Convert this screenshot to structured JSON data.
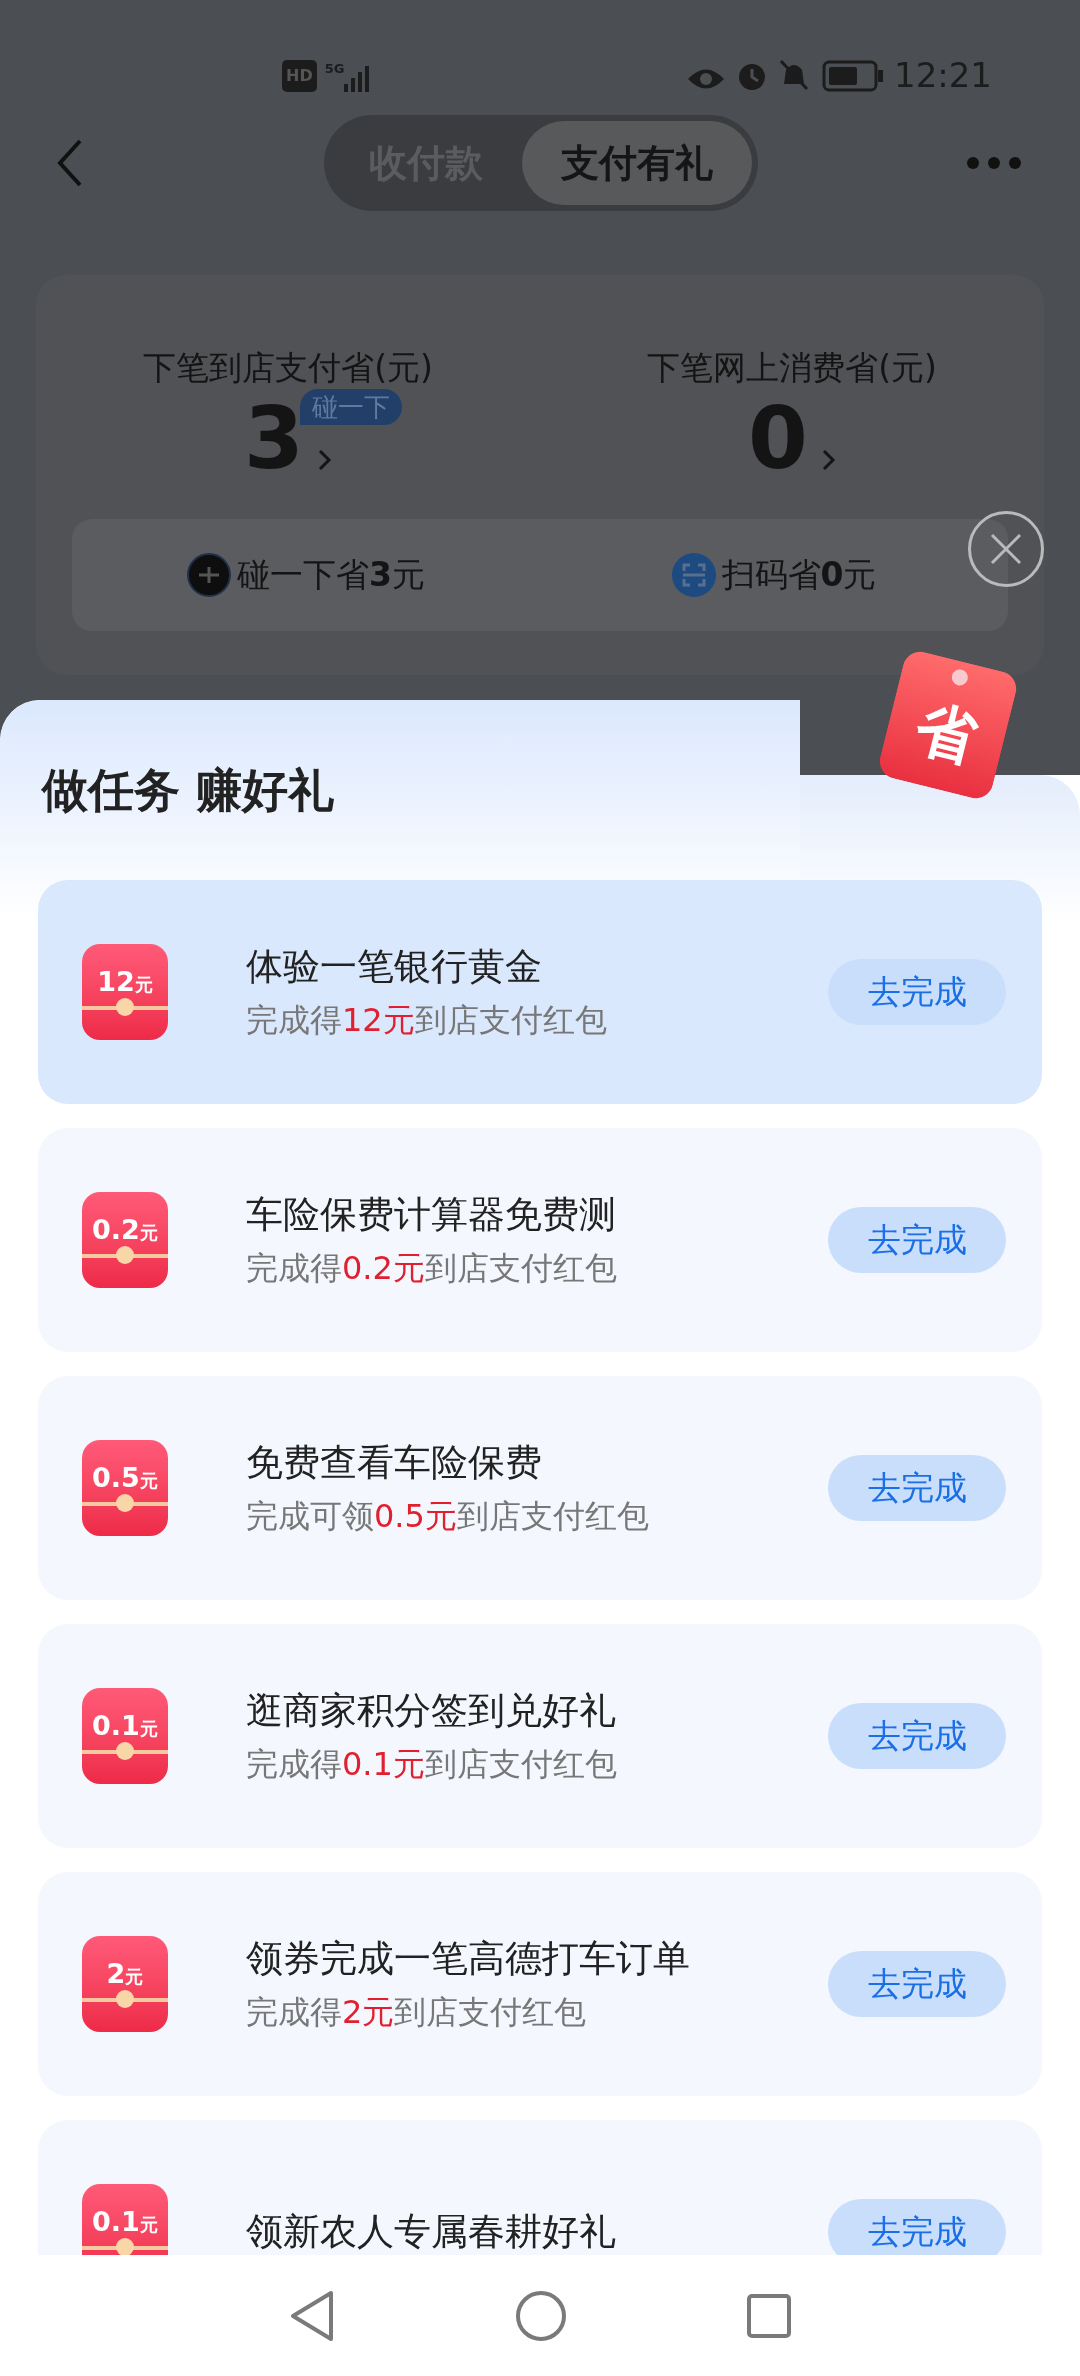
{
  "status_bar": {
    "badge": "HD",
    "network": "5G",
    "time": "12:21"
  },
  "tabs": [
    {
      "label": "收付款",
      "selected": false
    },
    {
      "label": "支付有礼",
      "selected": true
    }
  ],
  "summary": {
    "stats": [
      {
        "label": "下笔到店支付省(元)",
        "value": "3",
        "badge": "碰一下"
      },
      {
        "label": "下笔网上消费省(元)",
        "value": "0"
      }
    ],
    "methods": [
      {
        "kind": "tap",
        "text": "碰一下省**3**元"
      },
      {
        "kind": "scan",
        "text": "扫码省**0**元"
      }
    ]
  },
  "sheet": {
    "title": "做任务 赚好礼",
    "tag": "省",
    "tasks": [
      {
        "amount": "12",
        "unit": "元",
        "title": "体验一笔银行黄金",
        "prefix": "完成得",
        "reward": "12元",
        "suffix": "到店支付红包",
        "button": "去完成",
        "selected": true
      },
      {
        "amount": "0.2",
        "unit": "元",
        "title": "车险保费计算器免费测",
        "prefix": "完成得",
        "reward": "0.2元",
        "suffix": "到店支付红包",
        "button": "去完成",
        "selected": false
      },
      {
        "amount": "0.5",
        "unit": "元",
        "title": "免费查看车险保费",
        "prefix": "完成可领",
        "reward": "0.5元",
        "suffix": "到店支付红包",
        "button": "去完成",
        "selected": false
      },
      {
        "amount": "0.1",
        "unit": "元",
        "title": "逛商家积分签到兑好礼",
        "prefix": "完成得",
        "reward": "0.1元",
        "suffix": "到店支付红包",
        "button": "去完成",
        "selected": false
      },
      {
        "amount": "2",
        "unit": "元",
        "title": "领券完成一笔高德打车订单",
        "prefix": "完成得",
        "reward": "2元",
        "suffix": "到店支付红包",
        "button": "去完成",
        "selected": false
      },
      {
        "amount": "0.1",
        "unit": "元",
        "title": "领新农人专属春耕好礼",
        "button": "去完成",
        "selected": false
      }
    ]
  }
}
